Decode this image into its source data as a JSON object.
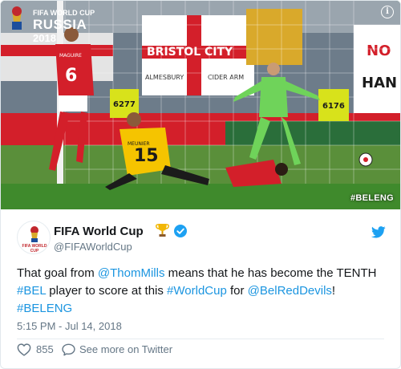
{
  "media": {
    "hashtag_overlay": "#BELENG",
    "watermark": {
      "line1": "FIFA WORLD CUP",
      "line2": "RUSSIA",
      "line3": "2018"
    },
    "banner_texts": [
      "BRISTOL CITY",
      "ALMESBURY",
      "CIDER ARM",
      "NO",
      "HAN"
    ],
    "jersey_numbers": [
      "6",
      "15"
    ],
    "jersey_names": [
      "MAGUIRE",
      "MEUNIER"
    ],
    "steward_numbers": [
      "6277",
      "6176"
    ],
    "colors": {
      "pitch": "#3f8a2c",
      "england_red": "#d31f2a",
      "belgium_yellow": "#f5c400",
      "keeper_green": "#6fd35a"
    }
  },
  "tweet": {
    "author_name": "FIFA World Cup",
    "author_handle": "@FIFAWorldCup",
    "badge_icons": [
      "trophy-icon",
      "verified-icon"
    ],
    "avatar_caption": "FIFA WORLD CUP",
    "text_parts": [
      {
        "text": "That goal from ",
        "link": false
      },
      {
        "text": "@ThomMills",
        "link": true
      },
      {
        "text": " means that he has become the TENTH ",
        "link": false
      },
      {
        "text": "#BEL",
        "link": true
      },
      {
        "text": " player to score at this ",
        "link": false
      },
      {
        "text": "#WorldCup",
        "link": true
      },
      {
        "text": " for ",
        "link": false
      },
      {
        "text": "@BelRedDevils",
        "link": true
      },
      {
        "text": "! ",
        "link": false
      },
      {
        "text": "#BELENG",
        "link": true
      }
    ],
    "timestamp": "5:15 PM - Jul 14, 2018",
    "like_count": "855",
    "see_more_label": "See more on Twitter",
    "colors": {
      "link": "#1b95e0",
      "muted": "#657786",
      "verified": "#1da1f2",
      "twitter_bird": "#1da1f2"
    }
  }
}
